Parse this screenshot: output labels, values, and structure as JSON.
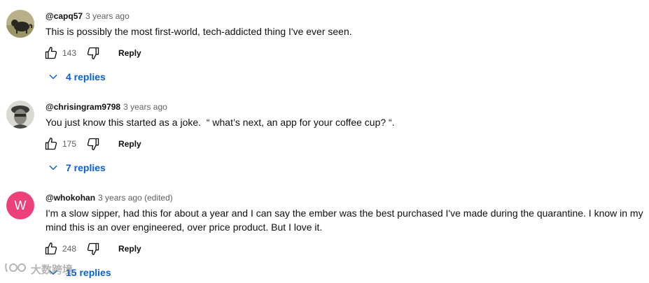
{
  "comments": [
    {
      "author": "@capq57",
      "time": "3 years ago",
      "text": "This is possibly the most first-world, tech-addicted thing I've ever seen.",
      "likes": "143",
      "reply_label": "Reply",
      "replies_label": "4 replies"
    },
    {
      "author": "@chrisingram9798",
      "time": "3 years ago",
      "text": "You just know this started as a joke.  “ what’s next, an app for your coffee cup? “.",
      "likes": "175",
      "reply_label": "Reply",
      "replies_label": "7 replies"
    },
    {
      "author": "@whokohan",
      "time": "3 years ago (edited)",
      "avatar_letter": "W",
      "avatar_color": "#ec407a",
      "text": "I'm a slow sipper, had this for about a year and I can say the ember was the best purchased I've made during the quarantine. I know in my mind this is an over engineered, over price product. But I love it.",
      "likes": "248",
      "reply_label": "Reply",
      "replies_label": "15 replies"
    }
  ],
  "watermark": {
    "text": "大数跨境"
  },
  "colors": {
    "link_blue": "#065fd4",
    "secondary_text": "#606060",
    "primary_text": "#0f0f0f"
  },
  "icons": {
    "like": "thumbs-up-outline",
    "dislike": "thumbs-down-outline",
    "expand": "chevron-down"
  }
}
